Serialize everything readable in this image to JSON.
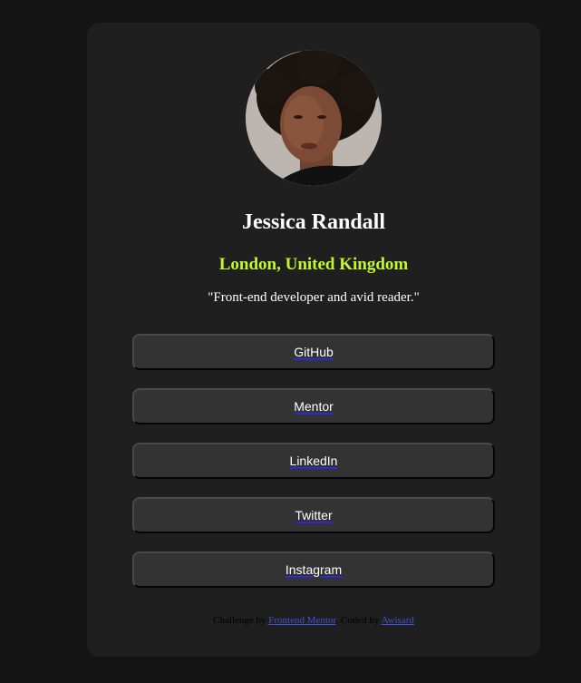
{
  "profile": {
    "avatar_alt": "Jessica Randall portrait",
    "name": "Jessica Randall",
    "location": "London, United Kingdom",
    "bio": "\"Front-end developer and avid reader.\""
  },
  "links": [
    {
      "label": "GitHub"
    },
    {
      "label": "Mentor"
    },
    {
      "label": "LinkedIn"
    },
    {
      "label": "Twitter"
    },
    {
      "label": "Instagram"
    }
  ],
  "footer": {
    "challenge_prefix": "Challenge by ",
    "challenge_link": "Frontend Mentor",
    "coded_prefix": ". Coded by ",
    "coded_link": "Awisard"
  },
  "colors": {
    "page_background": "#141414",
    "card_background": "#1f1f1f",
    "accent": "#c4f82a",
    "button_background": "#333333",
    "link_blue": "#4150d8"
  }
}
